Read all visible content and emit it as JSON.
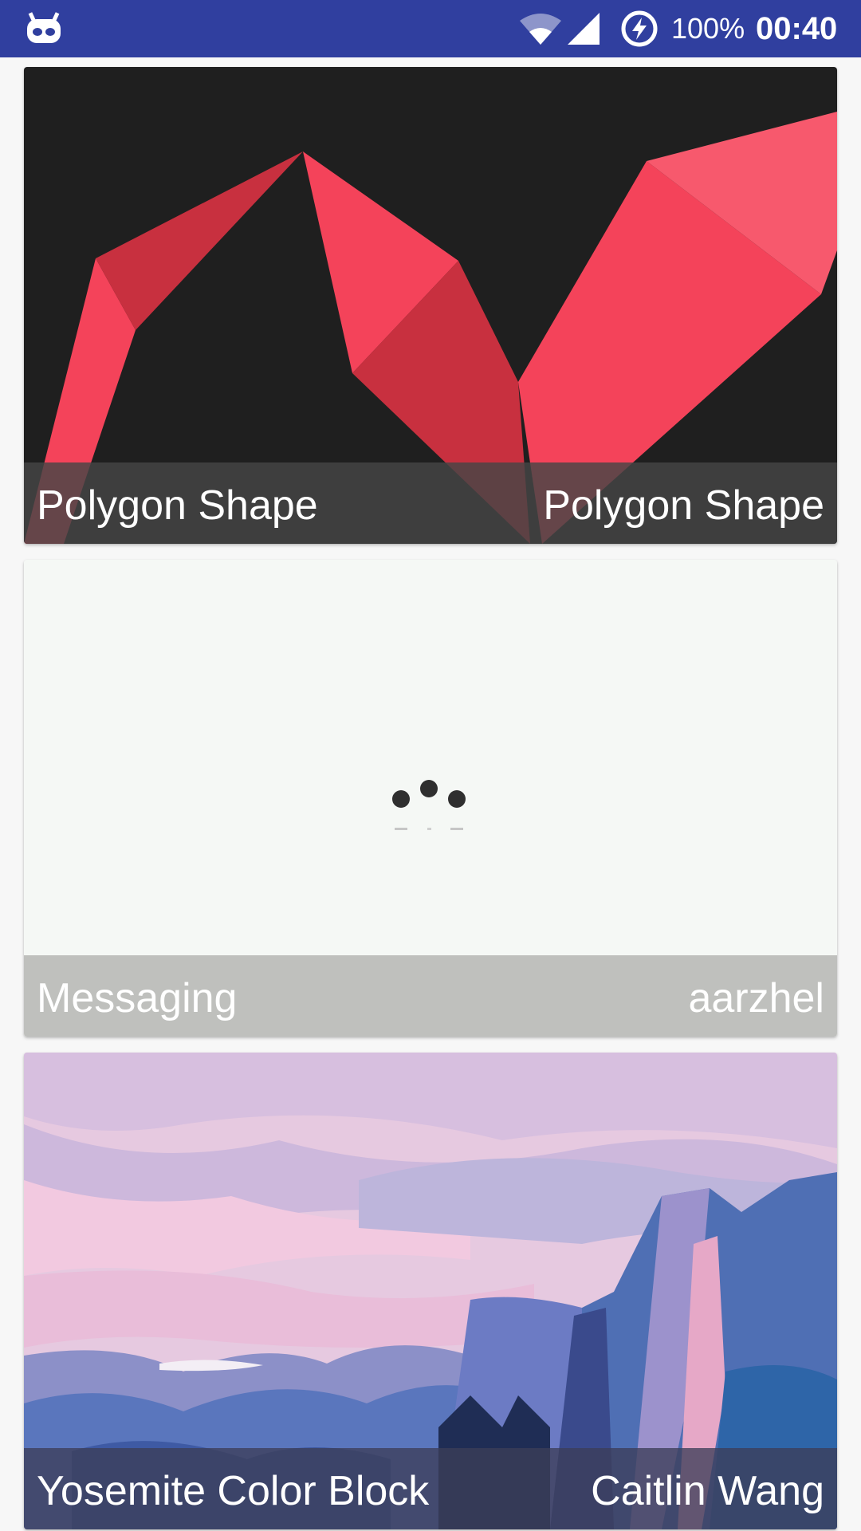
{
  "status_bar": {
    "left_icon": "android-debug-icon",
    "wifi_icon": "wifi-icon",
    "signal_icon": "cell-signal-icon",
    "battery_icon": "battery-charging-icon",
    "battery": "100%",
    "time": "00:40"
  },
  "cards": [
    {
      "title": "Polygon Shape",
      "author": "Polygon Shape",
      "art": "polygon-red-zigzag"
    },
    {
      "title": "Messaging",
      "author": "aarzhel",
      "art": "typing-dots"
    },
    {
      "title": "Yosemite Color Block",
      "author": "Caitlin Wang",
      "art": "yosemite-landscape"
    }
  ],
  "colors": {
    "status_bar": "#303f9f",
    "polygon_background": "#1f1f1f",
    "polygon_red": "#f4435a",
    "messaging_background": "#f5f8f5",
    "messaging_caption": "#bfc0bd",
    "yosemite_sky": "#e6c9e0",
    "yosemite_blue": "#4f6fb4"
  }
}
